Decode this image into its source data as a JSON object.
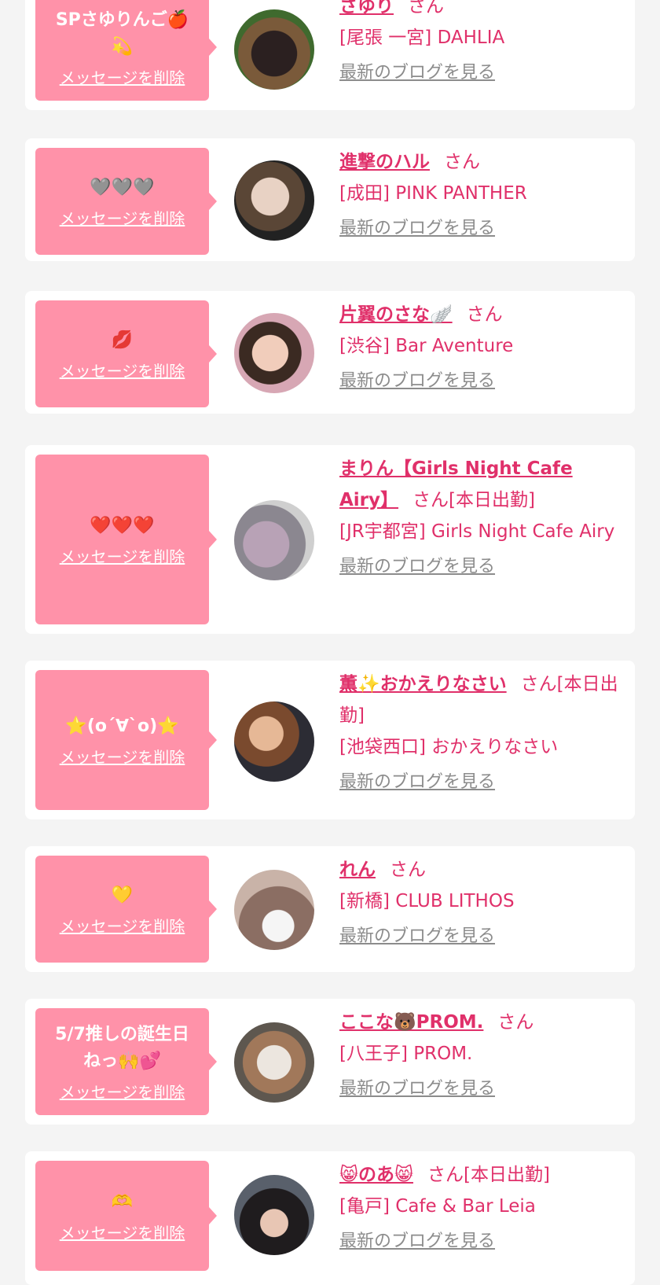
{
  "delete_label": "メッセージを削除",
  "blog_label": "最新のブログを見る",
  "san_label": "さん",
  "colors": {
    "accent": "#e0306a",
    "bubble": "#ff92a9",
    "link_gray": "#8c8c8c",
    "background": "#f4f4f4"
  },
  "entries": [
    {
      "message": "SPさゆりんご🍎💫",
      "name": "さゆり",
      "suffix": "さん",
      "shop": "[尾張 一宮] DAHLIA"
    },
    {
      "message": "🩶🩶🩶",
      "name": "進撃のハル",
      "suffix": "さん",
      "shop": "[成田] PINK PANTHER"
    },
    {
      "message": "💋",
      "name": "片翼のさな🪽",
      "suffix": "さん",
      "shop": "[渋谷] Bar Aventure"
    },
    {
      "message": "❤️❤️❤️",
      "name": "まりん【Girls Night Cafe Airy】",
      "suffix": "さん[本日出勤]",
      "shop": "[JR宇都宮] Girls Night Cafe Airy"
    },
    {
      "message": "⭐️(o´∀`o)⭐️",
      "name": "薫✨おかえりなさい",
      "suffix": "さん[本日出勤]",
      "shop": "[池袋西口] おかえりなさい"
    },
    {
      "message": "💛",
      "name": "れん",
      "suffix": "さん",
      "shop": "[新橋] CLUB LITHOS"
    },
    {
      "message": "5/7推しの誕生日ねっ🙌💕",
      "name": "ここな🐻PROM.",
      "suffix": "さん",
      "shop": "[八王子] PROM."
    },
    {
      "message": "🫶",
      "name": "😸のあ😸",
      "suffix": "さん[本日出勤]",
      "shop": "[亀戸] Cafe & Bar Leia"
    }
  ]
}
